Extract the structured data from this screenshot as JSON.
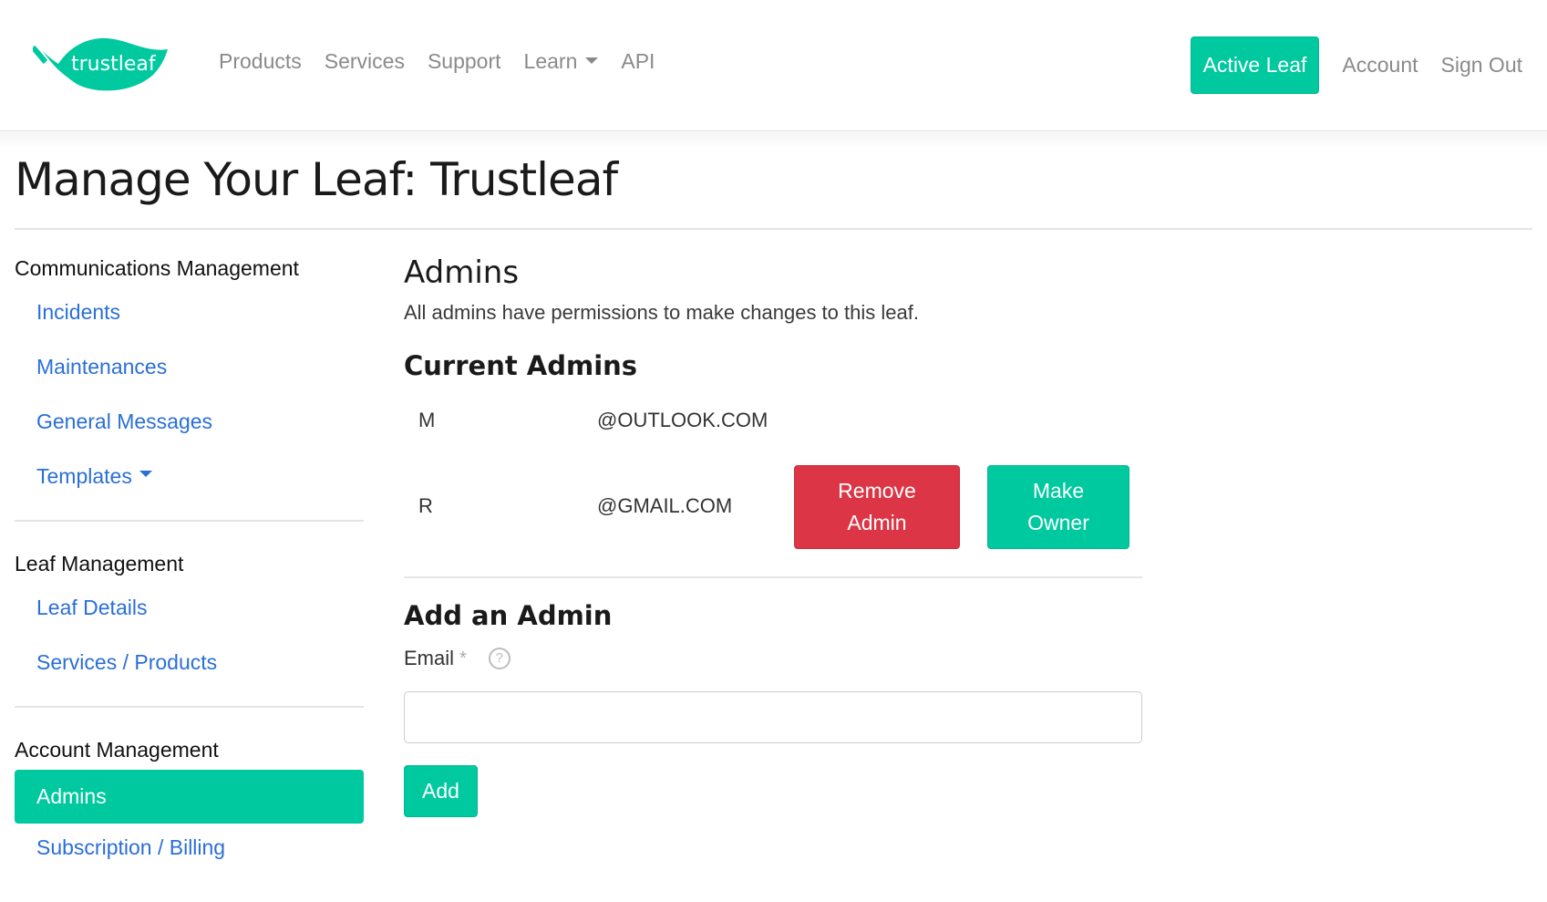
{
  "brand": {
    "name": "trustleaf",
    "color": "#00c9a0"
  },
  "nav": {
    "left": [
      {
        "label": "Products"
      },
      {
        "label": "Services"
      },
      {
        "label": "Support"
      },
      {
        "label": "Learn",
        "dropdown": true
      },
      {
        "label": "API"
      }
    ],
    "active_leaf": "Active Leaf",
    "account": "Account",
    "sign_out": "Sign Out"
  },
  "page": {
    "title": "Manage Your Leaf: Trustleaf"
  },
  "sidebar": {
    "groups": [
      {
        "heading": "Communications Management",
        "items": [
          {
            "label": "Incidents"
          },
          {
            "label": "Maintenances"
          },
          {
            "label": "General Messages"
          },
          {
            "label": "Templates",
            "dropdown": true
          }
        ]
      },
      {
        "heading": "Leaf Management",
        "items": [
          {
            "label": "Leaf Details"
          },
          {
            "label": "Services / Products"
          }
        ]
      },
      {
        "heading": "Account Management",
        "items": [
          {
            "label": "Admins",
            "active": true
          },
          {
            "label": "Subscription / Billing"
          }
        ]
      }
    ]
  },
  "main": {
    "heading": "Admins",
    "description": "All admins have permissions to make changes to this leaf.",
    "current_heading": "Current Admins",
    "admins": [
      {
        "name": "M",
        "email": "@OUTLOOK.COM"
      },
      {
        "name": "R",
        "email": "@GMAIL.COM",
        "remove_label_1": "Remove",
        "remove_label_2": "Admin",
        "owner_label_1": "Make",
        "owner_label_2": "Owner"
      }
    ],
    "add_heading": "Add an Admin",
    "email_label": "Email",
    "required_mark": "*",
    "help_glyph": "?",
    "email_value": "",
    "email_placeholder": "",
    "add_button": "Add"
  },
  "colors": {
    "accent": "#00c9a0",
    "danger": "#dc3545",
    "link": "#2a6fd6",
    "nav_text": "#8a8a8a"
  }
}
